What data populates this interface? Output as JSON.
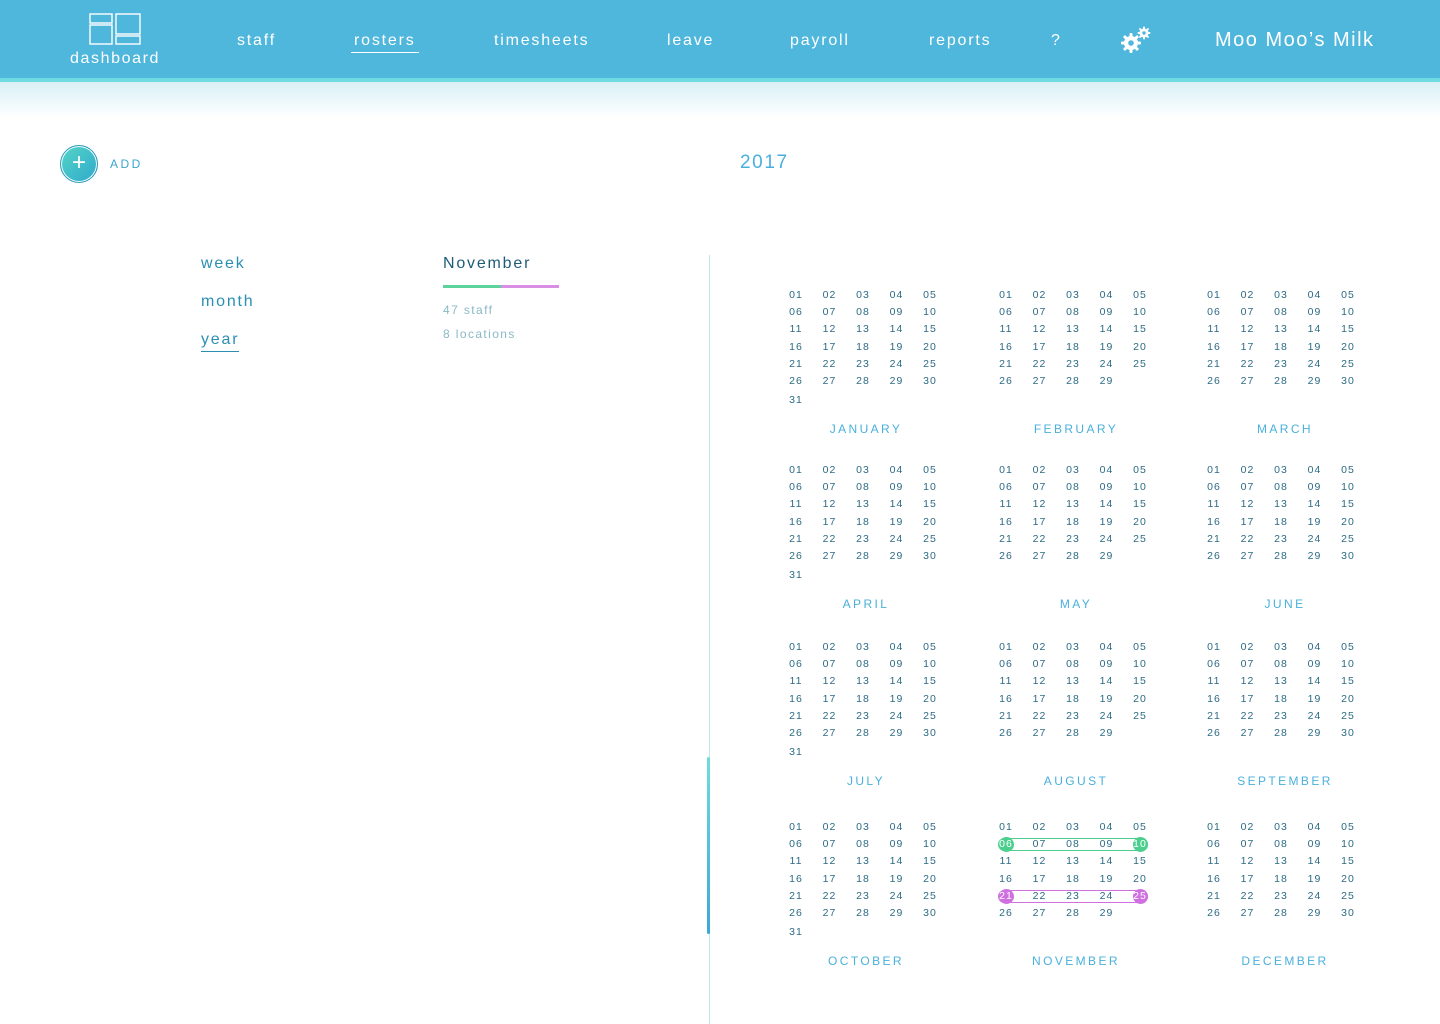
{
  "nav": {
    "dashboard_label": "dashboard",
    "items": [
      {
        "label": "staff"
      },
      {
        "label": "rosters",
        "active": true
      },
      {
        "label": "timesheets"
      },
      {
        "label": "leave"
      },
      {
        "label": "payroll"
      },
      {
        "label": "reports"
      }
    ],
    "help_label": "?",
    "settings_icon": "gears-icon",
    "company": "Moo Moo’s Milk"
  },
  "toolbar": {
    "add_label": "ADD",
    "add_icon": "plus-icon"
  },
  "year": "2017",
  "views": [
    {
      "label": "week"
    },
    {
      "label": "month"
    },
    {
      "label": "year",
      "active": true
    }
  ],
  "selected": {
    "month": "November",
    "staff": "47 staff",
    "locations": "8 locations"
  },
  "colors": {
    "accent": "#4fb6dc",
    "green_range": "#4ccf8e",
    "purple_range": "#cf6fe0"
  },
  "months": [
    {
      "name": "JANUARY",
      "days": 31
    },
    {
      "name": "FEBRUARY",
      "days": 29
    },
    {
      "name": "MARCH",
      "days": 30
    },
    {
      "name": "APRIL",
      "days": 31
    },
    {
      "name": "MAY",
      "days": 29
    },
    {
      "name": "JUNE",
      "days": 30
    },
    {
      "name": "JULY",
      "days": 31
    },
    {
      "name": "AUGUST",
      "days": 29
    },
    {
      "name": "SEPTEMBER",
      "days": 30
    },
    {
      "name": "OCTOBER",
      "days": 31
    },
    {
      "name": "NOVEMBER",
      "days": 29,
      "ranges": [
        {
          "from": 6,
          "to": 10,
          "color": "green"
        },
        {
          "from": 21,
          "to": 25,
          "color": "purple"
        }
      ]
    },
    {
      "name": "DECEMBER",
      "days": 30
    }
  ]
}
